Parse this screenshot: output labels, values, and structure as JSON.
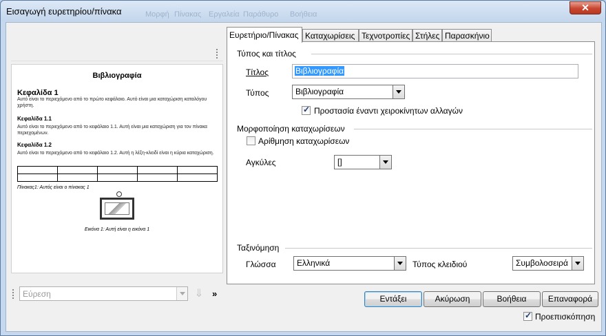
{
  "window": {
    "title": "Εισαγωγή ευρετηρίου/πίνακα",
    "ghost_menu": [
      "Μορφή",
      "Πίνακας",
      "Εργαλεία",
      "Παράθυρο",
      "Βοήθεια"
    ],
    "close_symbol": "✕"
  },
  "preview": {
    "title": "Βιβλιογραφία",
    "chapter1": {
      "heading": "Κεφαλίδα 1",
      "text": "Αυτό είναι το περιεχόμενο από το πρώτο κεφάλαιο. Αυτό είναι μια καταχώριση καταλόγου χρήστη."
    },
    "chapter11": {
      "heading": "Κεφαλίδα 1.1",
      "text": "Αυτό είναι το περιεχόμενο από το κεφάλαιο 1.1. Αυτή είναι μια καταχώριση για τον πίνακα περιεχομένων."
    },
    "chapter12": {
      "heading": "Κεφαλίδα 1.2",
      "text": "Αυτό είναι το περιεχόμενο από το κεφάλαιο 1.2. Αυτή η λέξη-κλειδί είναι η κύρια καταχώριση."
    },
    "table_caption": "Πίνακας1: Αυτός είναι ο πίνακας 1",
    "image_caption": "Εικόνα 1: Αυτή είναι η εικόνα 1"
  },
  "find": {
    "placeholder": "Εύρεση",
    "next_symbol": "⇓",
    "more_symbol": "»"
  },
  "tabs": [
    "Ευρετήριο/Πίνακας",
    "Καταχωρίσεις",
    "Τεχνοτροπίες",
    "Στήλες",
    "Παρασκήνιο"
  ],
  "type_title": {
    "section": "Τύπος και τίτλος",
    "title_label": "Τίτλος",
    "title_value": "Βιβλιογραφία",
    "type_label": "Τύπος",
    "type_value": "Βιβλιογραφία",
    "protect_label": "Προστασία έναντι χειροκίνητων αλλαγών",
    "protect_checked": true
  },
  "format": {
    "section": "Μορφοποίηση καταχωρίσεων",
    "numbering_label": "Αρίθμηση καταχωρίσεων",
    "numbering_checked": false,
    "brackets_label": "Αγκύλες",
    "brackets_value": "[]"
  },
  "sort": {
    "section": "Ταξινόμηση",
    "language_label": "Γλώσσα",
    "language_value": "Ελληνικά",
    "key_label": "Τύπος κλειδιού",
    "key_value": "Συμβολοσειρά"
  },
  "buttons": {
    "ok": "Εντάξει",
    "cancel": "Ακύρωση",
    "help": "Βοήθεια",
    "reset": "Επαναφορά"
  },
  "preview_toggle": {
    "label": "Προεπισκόπηση",
    "checked": true
  }
}
